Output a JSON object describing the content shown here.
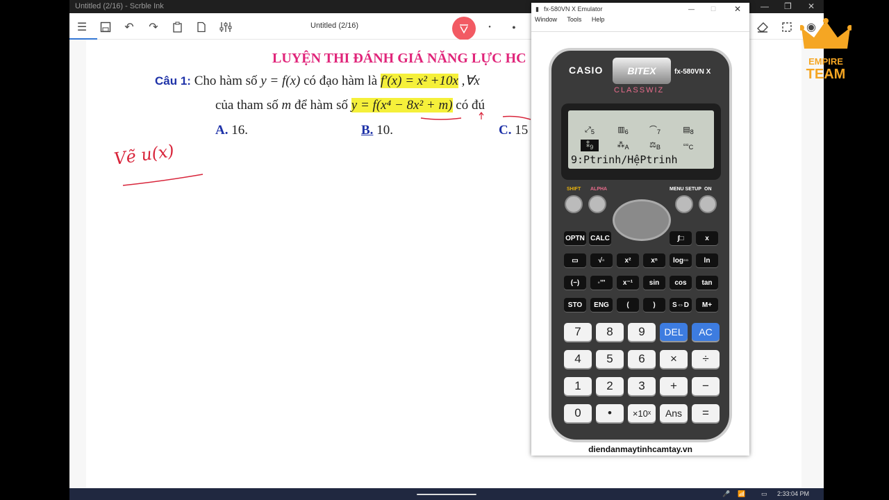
{
  "window": {
    "title": "Untitled (2/16) - Scrble Ink"
  },
  "toolbar": {
    "doc_title": "Untitled (2/16)"
  },
  "question": {
    "title": "LUYỆN THI ĐÁNH GIÁ NĂNG LỰC HC",
    "label": "Câu 1:",
    "line1_pre": "Cho hàm số ",
    "line1_eq1": "y = f(x)",
    "line1_mid": " có đạo hàm là ",
    "line1_deriv": "f′(x) = x² +10x",
    "line1_post": ",∀x",
    "line2_pre": "của tham số ",
    "line2_m": "m",
    "line2_mid": " để hàm số ",
    "line2_eq": "y = f(x⁴ − 8x² + m)",
    "line2_post": " có đú",
    "options": [
      {
        "letter": "A.",
        "value": "16."
      },
      {
        "letter": "B.",
        "value": "10."
      },
      {
        "letter": "C.",
        "value": "15"
      }
    ]
  },
  "handwriting": {
    "note": "Vẽ u(x)"
  },
  "emulator": {
    "title": "fx-580VN X Emulator",
    "menu": [
      "Window",
      "Tools",
      "Help"
    ],
    "brand": "CASIO",
    "model": "fx-580VN X",
    "series": "CLASSWIZ",
    "badge": "BITEX",
    "lcd_text": "9:Ptrinh/HệPtrinh",
    "lcd_nums": [
      "5",
      "6",
      "7",
      "8",
      "9",
      "A",
      "B",
      "C"
    ],
    "labels": {
      "shift": "SHIFT",
      "alpha": "ALPHA",
      "menu": "MENU SETUP",
      "on": "ON"
    },
    "keys_row1": [
      "OPTN",
      "CALC",
      "∫□",
      "x"
    ],
    "keys_row2": [
      "▭",
      "√▫",
      "x²",
      "xⁿ",
      "log▫▫",
      "ln"
    ],
    "keys_row3": [
      "(−)",
      "◦’’’",
      "x⁻¹",
      "sin",
      "cos",
      "tan"
    ],
    "keys_row4": [
      "STO",
      "ENG",
      "(",
      ")",
      "S⇔D",
      "M+"
    ],
    "num_row1": [
      "7",
      "8",
      "9",
      "DEL",
      "AC"
    ],
    "num_row2": [
      "4",
      "5",
      "6",
      "×",
      "÷"
    ],
    "num_row3": [
      "1",
      "2",
      "3",
      "+",
      "−"
    ],
    "num_row4": [
      "0",
      "•",
      "×10ˣ",
      "Ans",
      "="
    ],
    "footer": "diendanmaytinhcamtay.vn"
  },
  "logo": {
    "line1": "EMPIRE",
    "line2": "TEAM"
  },
  "tray": {
    "time": "2:33:04 PM"
  },
  "colors": {
    "accent_pen": "#f25a63",
    "title_pink": "#e0257a",
    "highlight": "#f5f03a",
    "option_blue": "#1e32a8",
    "logo_orange": "#f5a623"
  }
}
